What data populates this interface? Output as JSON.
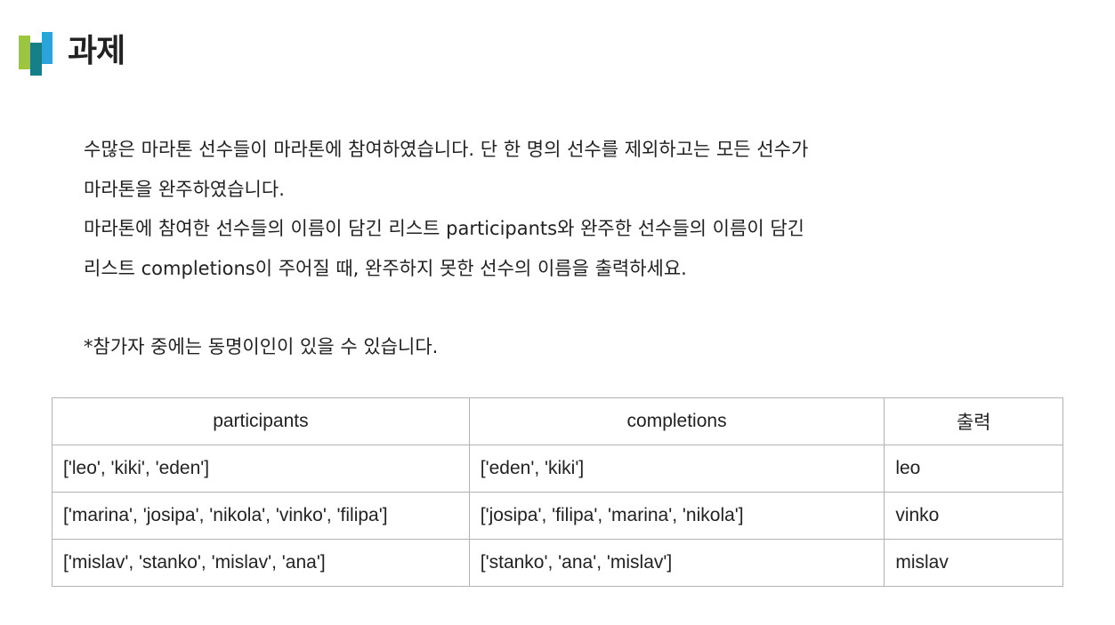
{
  "header": {
    "title": "과제",
    "logo_colors": [
      "#9cc63e",
      "#147f86",
      "#2aa4db"
    ]
  },
  "description": {
    "lines": [
      "수많은 마라톤 선수들이 마라톤에 참여하였습니다. 단 한 명의 선수를 제외하고는 모든 선수가",
      "마라톤을 완주하였습니다.",
      "마라톤에 참여한 선수들의 이름이 담긴 리스트 participants와 완주한 선수들의 이름이 담긴",
      "리스트 completions이 주어질 때, 완주하지 못한 선수의 이름을 출력하세요."
    ],
    "note": "*참가자 중에는 동명이인이 있을 수 있습니다."
  },
  "table": {
    "headers": [
      "participants",
      "completions",
      "출력"
    ],
    "rows": [
      [
        "['leo', 'kiki', 'eden']",
        "['eden', 'kiki']",
        "leo"
      ],
      [
        "['marina', 'josipa', 'nikola', 'vinko', 'filipa']",
        "['josipa', 'filipa', 'marina', 'nikola']",
        "vinko"
      ],
      [
        "['mislav', 'stanko', 'mislav', 'ana']",
        "['stanko', 'ana', 'mislav']",
        "mislav"
      ]
    ]
  }
}
